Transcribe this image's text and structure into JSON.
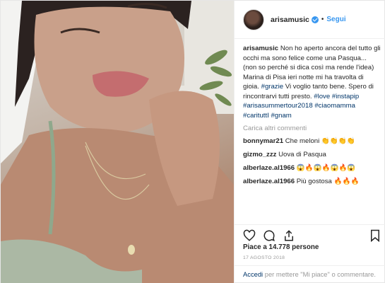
{
  "header": {
    "username": "arisamusic",
    "separator": "•",
    "follow_label": "Segui"
  },
  "caption": {
    "username": "arisamusic",
    "text_part1": "Non ho aperto ancora del tutto gli occhi ma sono felice come una Pasqua... (non so perché si dica così ma rende l'idea) Marina di Pisa ieri notte mi ha travolta di gioia.",
    "tag_grazie": "#grazie",
    "text_part2": " Vi voglio tanto bene. Spero di rincontrarvi tutti presto. ",
    "tag_love": "#love",
    "tag_instapip": "#instapip",
    "tag_tour": "#arisasummertour2018",
    "tag_ciaomamma": "#ciaomamma",
    "tag_caritutti": "#carituttI",
    "tag_gnam": "#gnam"
  },
  "load_more_label": "Carica altri commenti",
  "comments": [
    {
      "user": "bonnymar21",
      "text": "Che meloni 👏👏👏👏"
    },
    {
      "user": "gizmo_zzz",
      "text": "Uova di Pasqua"
    },
    {
      "user": "alberlaze.al1966",
      "text": "😱🔥😱🔥😱🔥😱"
    },
    {
      "user": "alberlaze.al1966",
      "text": "Più gostosa 🔥🔥🔥"
    }
  ],
  "actions": {
    "like_icon": "heart-icon",
    "comment_icon": "comment-icon",
    "share_icon": "share-icon",
    "save_icon": "bookmark-icon"
  },
  "likes_text": "Piace a 14.778 persone",
  "date_text": "17 AGOSTO 2018",
  "login": {
    "link": "Accedi",
    "text": " per mettere \"Mi piace\" o commentare."
  },
  "colors": {
    "link_blue": "#3897f0",
    "tag_blue": "#003569",
    "muted": "#999999"
  }
}
